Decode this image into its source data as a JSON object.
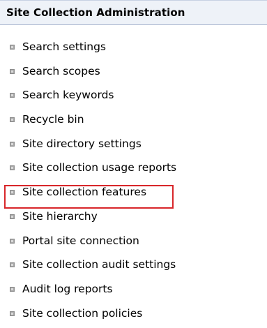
{
  "panel": {
    "title": "Site Collection Administration",
    "items": [
      {
        "label": "Search settings",
        "icon": "bullet-square-icon"
      },
      {
        "label": "Search scopes",
        "icon": "bullet-square-icon"
      },
      {
        "label": "Search keywords",
        "icon": "bullet-square-icon"
      },
      {
        "label": "Recycle bin",
        "icon": "bullet-square-icon"
      },
      {
        "label": "Site directory settings",
        "icon": "bullet-square-icon"
      },
      {
        "label": "Site collection usage reports",
        "icon": "bullet-square-icon"
      },
      {
        "label": "Site collection features",
        "icon": "bullet-square-icon",
        "highlighted": true
      },
      {
        "label": "Site hierarchy",
        "icon": "bullet-square-icon"
      },
      {
        "label": "Portal site connection",
        "icon": "bullet-square-icon"
      },
      {
        "label": "Site collection audit settings",
        "icon": "bullet-square-icon"
      },
      {
        "label": "Audit log reports",
        "icon": "bullet-square-icon"
      },
      {
        "label": "Site collection policies",
        "icon": "bullet-square-icon"
      }
    ],
    "highlight_color": "#d8262a"
  }
}
